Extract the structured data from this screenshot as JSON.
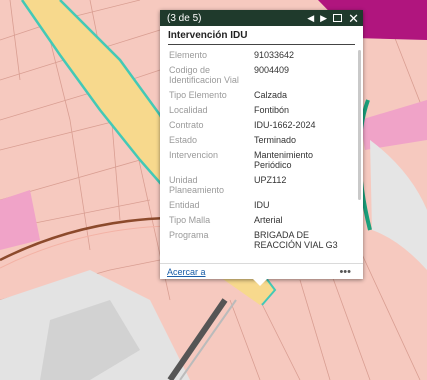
{
  "popup": {
    "page_indicator": "(3 de 5)",
    "title": "Intervención IDU",
    "attributes": [
      {
        "label": "Elemento",
        "value": "91033642"
      },
      {
        "label": "Codigo de Identificacion Vial",
        "value": "9004409"
      },
      {
        "label": "Tipo Elemento",
        "value": "Calzada"
      },
      {
        "label": "Localidad",
        "value": "Fontibón"
      },
      {
        "label": "Contrato",
        "value": "IDU-1662-2024"
      },
      {
        "label": "Estado",
        "value": "Terminado"
      },
      {
        "label": "Intervencion",
        "value": "Mantenimiento Periódico"
      },
      {
        "label": "Unidad Planeamiento",
        "value": "UPZ112"
      },
      {
        "label": "Entidad",
        "value": "IDU"
      },
      {
        "label": "Tipo Malla",
        "value": "Arterial"
      },
      {
        "label": "Programa",
        "value": "BRIGADA DE REACCIÓN VIAL G3"
      }
    ],
    "zoom_link": "Acercar a",
    "more_symbol": "•••",
    "prev_symbol": "◀",
    "next_symbol": "▶",
    "close_symbol": "✕"
  },
  "colors": {
    "titlebar": "#1f3a2c",
    "parcel_pink": "#f6c9bf",
    "road_yellow": "#f7d98d",
    "highlight_cyan": "#43c9b6",
    "magenta_zone": "#b0157e",
    "road_gray": "#d2d2d2",
    "rail_brown": "#8c4a2c",
    "link_blue": "#1a5ea8"
  }
}
